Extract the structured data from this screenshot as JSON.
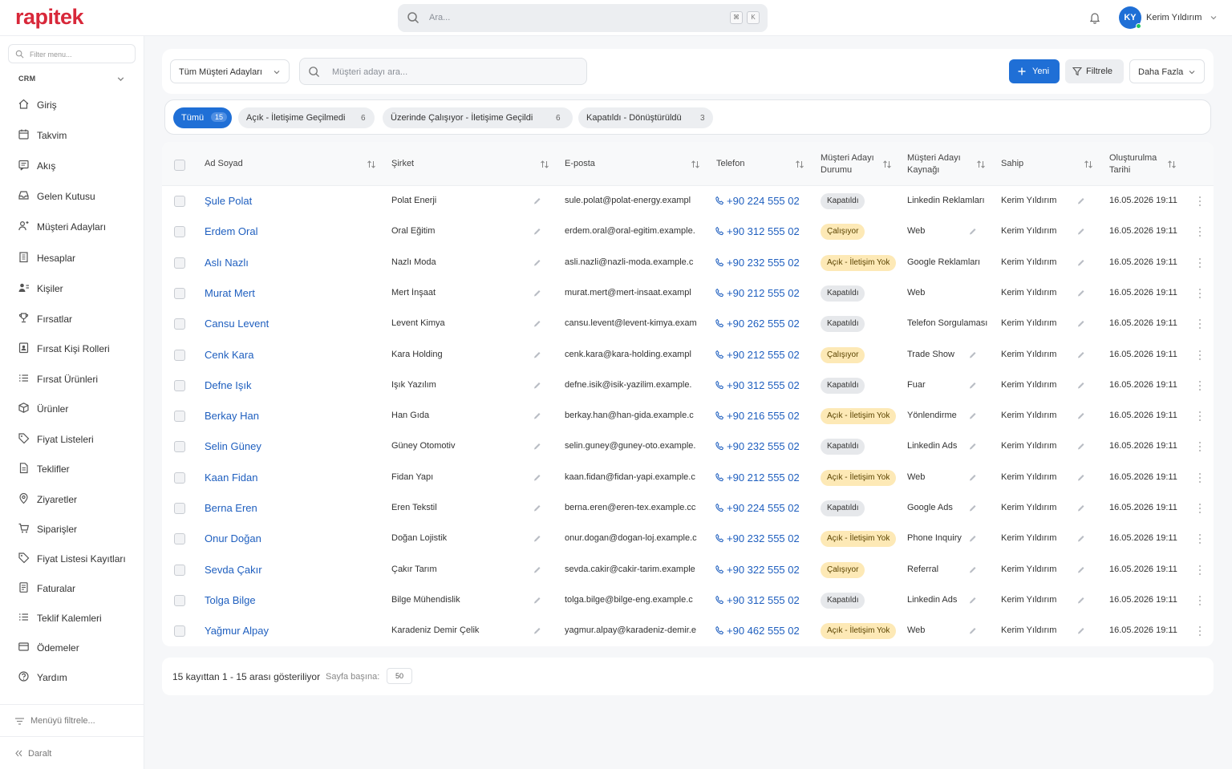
{
  "header": {
    "logo": "rapitek",
    "search_placeholder": "Ara...",
    "kbd1": "⌘",
    "kbd2": "K",
    "avatar_initials": "KY",
    "user_name": "Kerim Yıldırım"
  },
  "sidebar": {
    "filter_placeholder": "Filter menu...",
    "section": "CRM",
    "items": [
      {
        "label": "Giriş",
        "icon": "home-icon"
      },
      {
        "label": "Takvim",
        "icon": "calendar-icon"
      },
      {
        "label": "Akış",
        "icon": "stream-icon"
      },
      {
        "label": "Gelen Kutusu",
        "icon": "inbox-icon"
      },
      {
        "label": "Müşteri Adayları",
        "icon": "leads-icon"
      },
      {
        "label": "Hesaplar",
        "icon": "building-icon"
      },
      {
        "label": "Kişiler",
        "icon": "contacts-icon"
      },
      {
        "label": "Fırsatlar",
        "icon": "trophy-icon"
      },
      {
        "label": "Fırsat Kişi Rolleri",
        "icon": "contact-role-icon"
      },
      {
        "label": "Fırsat Ürünleri",
        "icon": "list-icon"
      },
      {
        "label": "Ürünler",
        "icon": "box-icon"
      },
      {
        "label": "Fiyat Listeleri",
        "icon": "tag-icon"
      },
      {
        "label": "Teklifler",
        "icon": "document-icon"
      },
      {
        "label": "Ziyaretler",
        "icon": "map-pin-icon"
      },
      {
        "label": "Siparişler",
        "icon": "cart-icon"
      },
      {
        "label": "Fiyat Listesi Kayıtları",
        "icon": "tag-icon"
      },
      {
        "label": "Faturalar",
        "icon": "invoice-icon"
      },
      {
        "label": "Teklif Kalemleri",
        "icon": "list-icon"
      },
      {
        "label": "Ödemeler",
        "icon": "credit-card-icon"
      },
      {
        "label": "Yardım",
        "icon": "help-icon"
      }
    ],
    "menu_filter": "Menüyü filtrele...",
    "collapse": "Daralt"
  },
  "toolbar": {
    "view": "Tüm Müşteri Adayları",
    "search_placeholder": "Müşteri adayı ara...",
    "new": "Yeni",
    "filter": "Filtrele",
    "more": "Daha Fazla"
  },
  "tabs": [
    {
      "label": "Tümü",
      "count": "15",
      "active": true
    },
    {
      "label": "Açık - İletişime Geçilmedi",
      "count": "6"
    },
    {
      "label": "Üzerinde Çalışıyor - İletişime Geçildi",
      "count": "6"
    },
    {
      "label": "Kapatıldı - Dönüştürüldü",
      "count": "3"
    }
  ],
  "table": {
    "headers": {
      "name": "Ad Soyad",
      "company": "Şirket",
      "email": "E-posta",
      "phone": "Telefon",
      "status1": "Müşteri Adayı",
      "status2": "Durumu",
      "source1": "Müşteri Adayı",
      "source2": "Kaynağı",
      "owner": "Sahip",
      "created1": "Oluşturulma",
      "created2": "Tarihi"
    },
    "badge_colors": {
      "Kapatıldı": {
        "bg": "#e6e8eb",
        "fg": "#333333"
      },
      "Çalışıyor": {
        "bg": "#fde9b6",
        "fg": "#5a4300"
      },
      "Açık - İletişim Yok": {
        "bg": "#fde9b6",
        "fg": "#5a4300"
      }
    },
    "rows": [
      {
        "name": "Şule Polat",
        "company": "Polat Enerji",
        "email": "sule.polat@polat-energy.exampl",
        "phone": "+90 224 555 02",
        "status": "Kapatıldı",
        "source": "Linkedin Reklamları",
        "source_edit": false,
        "owner": "Kerim Yıldırım",
        "created": "16.05.2026 19:11"
      },
      {
        "name": "Erdem Oral",
        "company": "Oral Eğitim",
        "email": "erdem.oral@oral-egitim.example.",
        "phone": "+90 312 555 02",
        "status": "Çalışıyor",
        "source": "Web",
        "source_edit": true,
        "owner": "Kerim Yıldırım",
        "created": "16.05.2026 19:11"
      },
      {
        "name": "Aslı Nazlı",
        "company": "Nazlı Moda",
        "email": "asli.nazli@nazli-moda.example.c",
        "phone": "+90 232 555 02",
        "status": "Açık - İletişim Yok",
        "source": "Google Reklamları",
        "source_edit": false,
        "owner": "Kerim Yıldırım",
        "created": "16.05.2026 19:11"
      },
      {
        "name": "Murat Mert",
        "company": "Mert İnşaat",
        "email": "murat.mert@mert-insaat.exampl",
        "phone": "+90 212 555 02",
        "status": "Kapatıldı",
        "source": "Web",
        "source_edit": false,
        "owner": "Kerim Yıldırım",
        "created": "16.05.2026 19:11"
      },
      {
        "name": "Cansu Levent",
        "company": "Levent Kimya",
        "email": "cansu.levent@levent-kimya.exam",
        "phone": "+90 262 555 02",
        "status": "Kapatıldı",
        "source": "Telefon Sorgulaması",
        "source_edit": false,
        "owner": "Kerim Yıldırım",
        "created": "16.05.2026 19:11"
      },
      {
        "name": "Cenk Kara",
        "company": "Kara Holding",
        "email": "cenk.kara@kara-holding.exampl",
        "phone": "+90 212 555 02",
        "status": "Çalışıyor",
        "source": "Trade Show",
        "source_edit": true,
        "owner": "Kerim Yıldırım",
        "created": "16.05.2026 19:11"
      },
      {
        "name": "Defne Işık",
        "company": "Işık Yazılım",
        "email": "defne.isik@isik-yazilim.example.",
        "phone": "+90 312 555 02",
        "status": "Kapatıldı",
        "source": "Fuar",
        "source_edit": true,
        "owner": "Kerim Yıldırım",
        "created": "16.05.2026 19:11"
      },
      {
        "name": "Berkay Han",
        "company": "Han Gıda",
        "email": "berkay.han@han-gida.example.c",
        "phone": "+90 216 555 02",
        "status": "Açık - İletişim Yok",
        "source": "Yönlendirme",
        "source_edit": true,
        "owner": "Kerim Yıldırım",
        "created": "16.05.2026 19:11"
      },
      {
        "name": "Selin Güney",
        "company": "Güney Otomotiv",
        "email": "selin.guney@guney-oto.example.",
        "phone": "+90 232 555 02",
        "status": "Kapatıldı",
        "source": "Linkedin Ads",
        "source_edit": true,
        "owner": "Kerim Yıldırım",
        "created": "16.05.2026 19:11"
      },
      {
        "name": "Kaan Fidan",
        "company": "Fidan Yapı",
        "email": "kaan.fidan@fidan-yapi.example.c",
        "phone": "+90 212 555 02",
        "status": "Açık - İletişim Yok",
        "source": "Web",
        "source_edit": true,
        "owner": "Kerim Yıldırım",
        "created": "16.05.2026 19:11"
      },
      {
        "name": "Berna Eren",
        "company": "Eren Tekstil",
        "email": "berna.eren@eren-tex.example.cc",
        "phone": "+90 224 555 02",
        "status": "Kapatıldı",
        "source": "Google Ads",
        "source_edit": true,
        "owner": "Kerim Yıldırım",
        "created": "16.05.2026 19:11"
      },
      {
        "name": "Onur Doğan",
        "company": "Doğan Lojistik",
        "email": "onur.dogan@dogan-loj.example.c",
        "phone": "+90 232 555 02",
        "status": "Açık - İletişim Yok",
        "source": "Phone Inquiry",
        "source_edit": true,
        "owner": "Kerim Yıldırım",
        "created": "16.05.2026 19:11"
      },
      {
        "name": "Sevda Çakır",
        "company": "Çakır Tarım",
        "email": "sevda.cakir@cakir-tarim.example",
        "phone": "+90 322 555 02",
        "status": "Çalışıyor",
        "source": "Referral",
        "source_edit": true,
        "owner": "Kerim Yıldırım",
        "created": "16.05.2026 19:11"
      },
      {
        "name": "Tolga Bilge",
        "company": "Bilge Mühendislik",
        "email": "tolga.bilge@bilge-eng.example.c",
        "phone": "+90 312 555 02",
        "status": "Kapatıldı",
        "source": "Linkedin Ads",
        "source_edit": true,
        "owner": "Kerim Yıldırım",
        "created": "16.05.2026 19:11"
      },
      {
        "name": "Yağmur Alpay",
        "company": "Karadeniz Demir Çelik",
        "email": "yagmur.alpay@karadeniz-demir.e",
        "phone": "+90 462 555 02",
        "status": "Açık - İletişim Yok",
        "source": "Web",
        "source_edit": true,
        "owner": "Kerim Yıldırım",
        "created": "16.05.2026 19:11"
      }
    ]
  },
  "pagination": {
    "info": "15 kayıttan 1 - 15 arası gösteriliyor",
    "per_page_label": "Sayfa başına:",
    "per_page": "50"
  }
}
